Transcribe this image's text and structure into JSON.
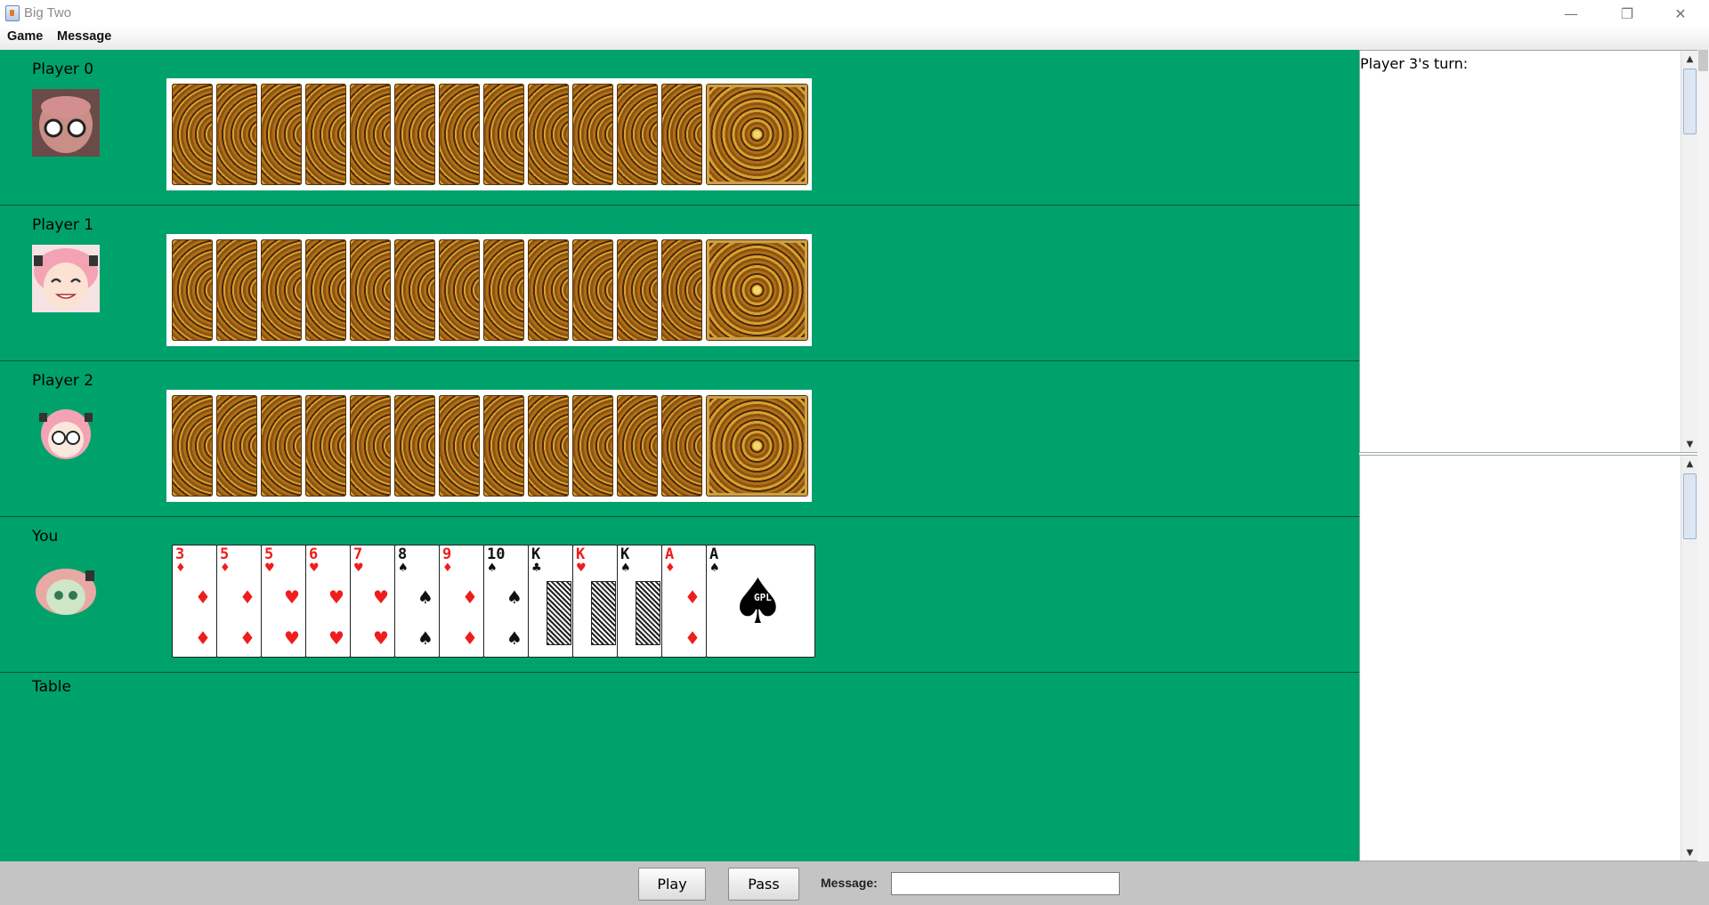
{
  "window": {
    "title": "Big Two",
    "controls": [
      "—",
      "❐",
      "✕"
    ]
  },
  "menu": {
    "items": [
      "Game",
      "Message"
    ]
  },
  "players": [
    {
      "label": "Player 0",
      "avatar": "avatar-0",
      "card_count": 13
    },
    {
      "label": "Player 1",
      "avatar": "avatar-1",
      "card_count": 13
    },
    {
      "label": "Player 2",
      "avatar": "avatar-2",
      "card_count": 13
    },
    {
      "label": "You",
      "avatar": "avatar-you",
      "card_count": 13
    }
  ],
  "hand": [
    {
      "rank": "3",
      "suit": "♦",
      "color": "red"
    },
    {
      "rank": "5",
      "suit": "♦",
      "color": "red"
    },
    {
      "rank": "5",
      "suit": "♥",
      "color": "red"
    },
    {
      "rank": "6",
      "suit": "♥",
      "color": "red"
    },
    {
      "rank": "7",
      "suit": "♥",
      "color": "red"
    },
    {
      "rank": "8",
      "suit": "♠",
      "color": "black"
    },
    {
      "rank": "9",
      "suit": "♦",
      "color": "red"
    },
    {
      "rank": "10",
      "suit": "♠",
      "color": "black"
    },
    {
      "rank": "K",
      "suit": "♣",
      "color": "black"
    },
    {
      "rank": "K",
      "suit": "♥",
      "color": "red"
    },
    {
      "rank": "K",
      "suit": "♠",
      "color": "black"
    },
    {
      "rank": "A",
      "suit": "♦",
      "color": "red"
    },
    {
      "rank": "A",
      "suit": "♠",
      "color": "black",
      "logo": "GPL"
    }
  ],
  "table": {
    "label": "Table"
  },
  "message_area": {
    "text": "Player 3's turn:"
  },
  "chat_area": {
    "text": ""
  },
  "bottom": {
    "play_label": "Play",
    "pass_label": "Pass",
    "message_label": "Message:",
    "message_value": ""
  },
  "colors": {
    "table_green": "#00a26c",
    "red_suit": "#ef1d1d",
    "bottom_bar": "#c4c4c4"
  }
}
